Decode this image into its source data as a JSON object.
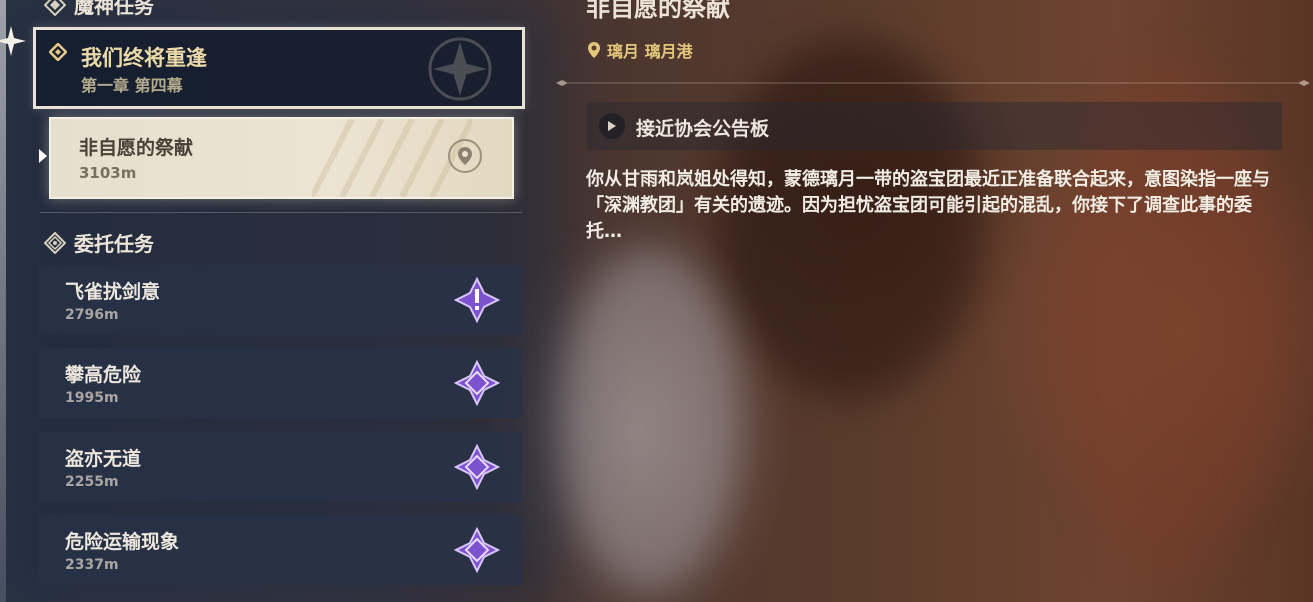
{
  "archon_section": {
    "header": "魔神任务",
    "quest_title": "我们终将重逢",
    "quest_chapter": "第一章 第四幕",
    "subquest": {
      "title": "非自愿的祭献",
      "distance": "3103m"
    }
  },
  "commission_section": {
    "header": "委托任务",
    "items": [
      {
        "title": "飞雀扰剑意",
        "distance": "2796m",
        "icon": "commission-alert-icon"
      },
      {
        "title": "攀高危险",
        "distance": "1995m",
        "icon": "commission-star-icon"
      },
      {
        "title": "盗亦无道",
        "distance": "2255m",
        "icon": "commission-star-icon"
      },
      {
        "title": "危险运输现象",
        "distance": "2337m",
        "icon": "commission-star-icon"
      }
    ]
  },
  "detail": {
    "title": "非自愿的祭献",
    "location": "璃月 璃月港",
    "objective": "接近协会公告板",
    "description": "你从甘雨和岚姐处得知，蒙德璃月一带的盗宝团最近正准备联合起来，意图染指一座与「深渊教团」有关的遗迹。因为担忧盗宝团可能引起的混乱，你接下了调查此事的委托…"
  },
  "colors": {
    "archon_gold": "#ecd9a8",
    "location_gold": "#e4c67b",
    "commission_purple": "#8a5bd6"
  }
}
